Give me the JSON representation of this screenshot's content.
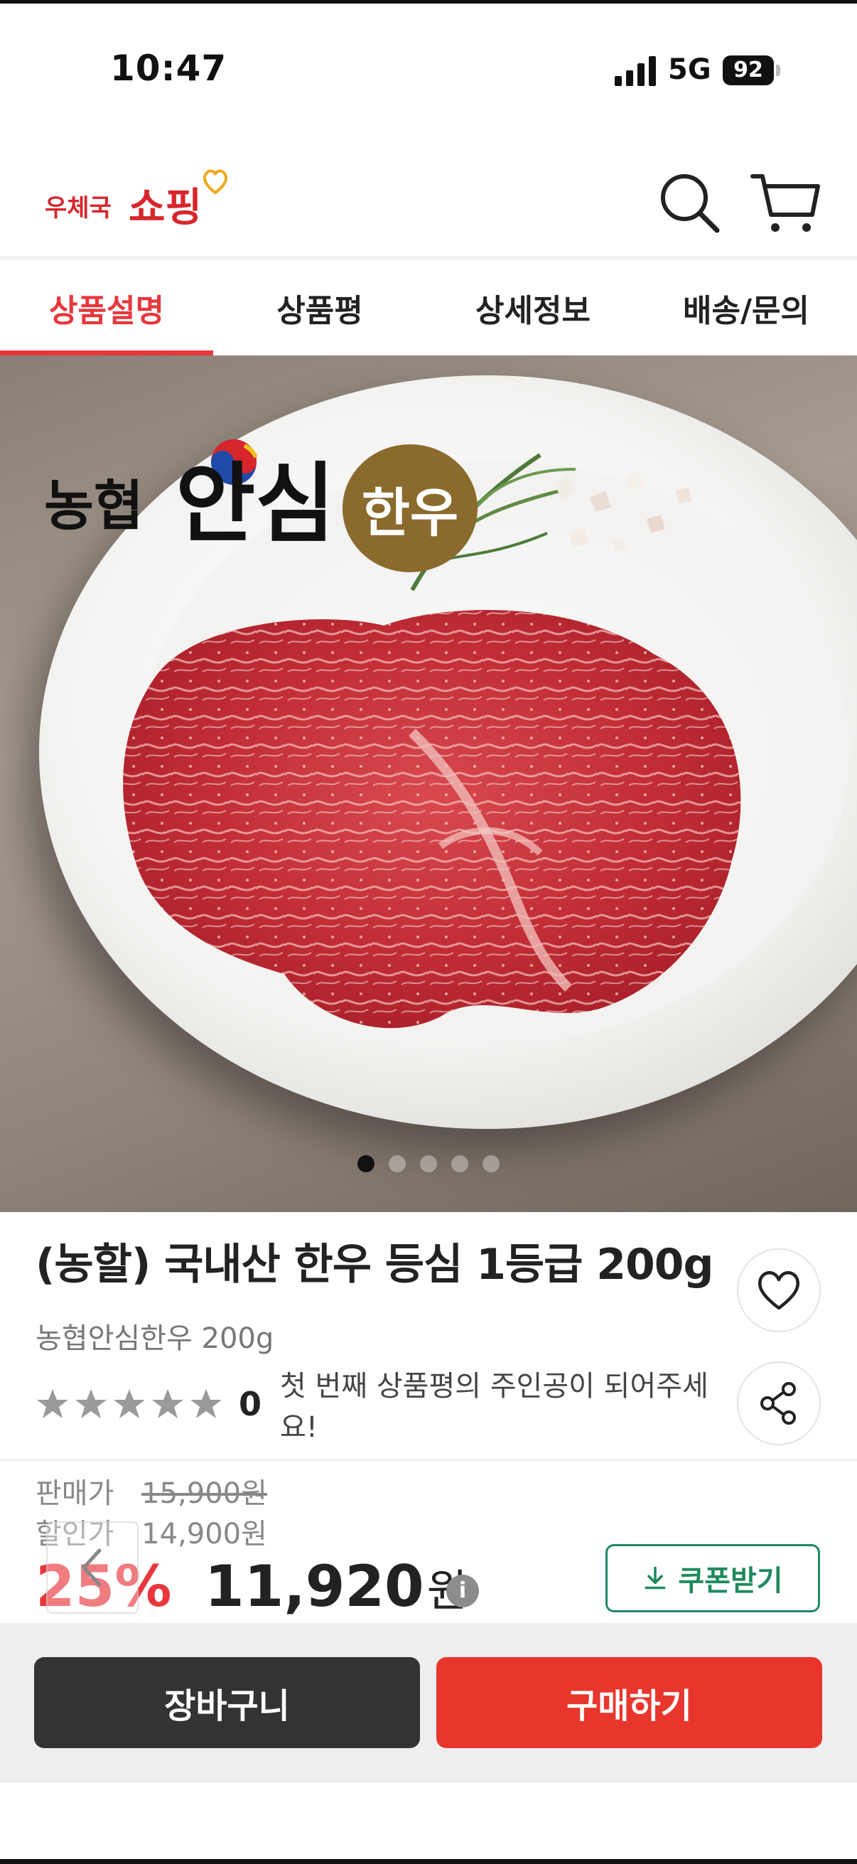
{
  "status_bar": {
    "time": "10:47",
    "network": "5G",
    "battery": "92"
  },
  "header": {
    "logo_small": "우체국",
    "logo_big": "쇼핑",
    "search_icon": "search-icon",
    "cart_icon": "cart-icon"
  },
  "tabs": [
    {
      "label": "상품설명",
      "active": true
    },
    {
      "label": "상품평",
      "active": false
    },
    {
      "label": "상세정보",
      "active": false
    },
    {
      "label": "배송/문의",
      "active": false
    }
  ],
  "hero": {
    "brand_prefix": "농협",
    "brand_main": "안심",
    "brand_badge": "한우",
    "slide_count": 5,
    "active_slide": 1
  },
  "product": {
    "title": "(농할) 국내산 한우 등심 1등급 200g",
    "subtitle": "농협안심한우 200g",
    "rating_count": "0",
    "rating_prompt": "첫 번째 상품평의 주인공이 되어주세요!",
    "stars_filled": 0,
    "stars_total": 5
  },
  "price": {
    "list_label": "판매가",
    "list_value": "15,900원",
    "sale_label": "할인가",
    "sale_value": "14,900원",
    "discount_rate": "25%",
    "final_amount": "11,920",
    "final_unit": "원",
    "info_label": "i",
    "coupon_label": "쿠폰받기"
  },
  "bottom_bar": {
    "cart_label": "장바구니",
    "buy_label": "구매하기"
  },
  "colors": {
    "accent": "#e8373c",
    "coupon": "#1e8a5f",
    "cart_button": "#333333",
    "buy_button": "#e8362c"
  }
}
